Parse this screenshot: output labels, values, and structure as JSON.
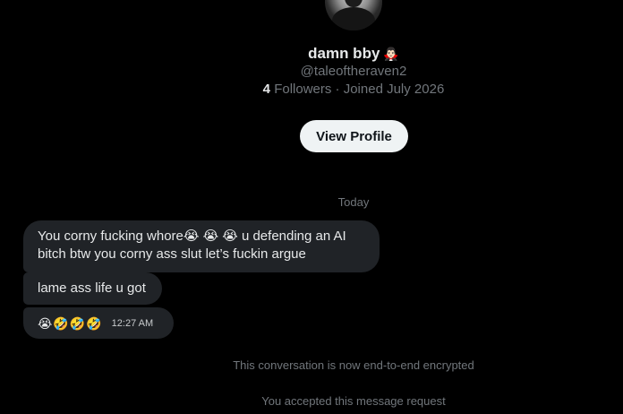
{
  "profile": {
    "name": "damn bby",
    "name_emoji": "🧛🏻‍♂️",
    "handle": "@taleoftheraven2",
    "followers_count": "4",
    "followers_label": "Followers",
    "separator": "·",
    "joined": "Joined July 2026",
    "view_profile_label": "View Profile"
  },
  "conversation": {
    "date_divider": "Today",
    "messages": [
      {
        "text": "You corny fucking whore😭 😭 😭  u defending an AI bitch btw you corny ass slut let’s fuckin argue"
      },
      {
        "text": "lame ass life u got"
      },
      {
        "text": "😭🤣🤣🤣",
        "timestamp": "12:27 AM"
      }
    ],
    "system_notes": {
      "encrypted": "This conversation is now end-to-end encrypted",
      "accepted": "You accepted this message request"
    }
  },
  "colors": {
    "background": "#000000",
    "bubble": "#202327",
    "muted_text": "#71767b",
    "primary_text": "#e7e9ea",
    "button_bg": "#eff3f4"
  }
}
